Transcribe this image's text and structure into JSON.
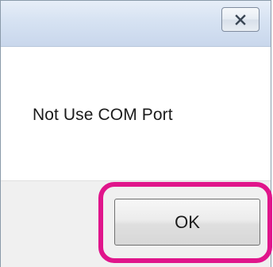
{
  "dialog": {
    "message": "Not Use COM Port",
    "close_icon": "close-icon",
    "ok_label": "OK"
  },
  "highlight": {
    "color": "#e0158b",
    "target": "ok-button"
  }
}
